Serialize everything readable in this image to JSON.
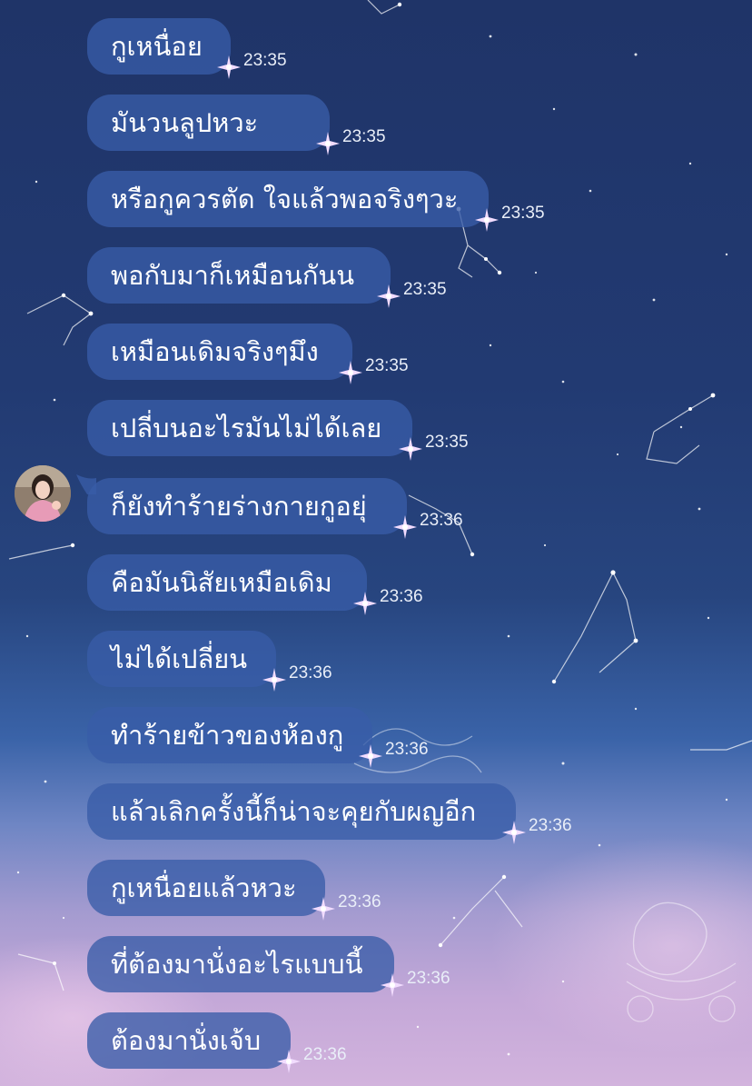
{
  "colors": {
    "bubble": "#385ca8",
    "text": "#ffffff",
    "time": "#e9eef8",
    "sparkle": "#f2dcff"
  },
  "chat": {
    "messages": [
      {
        "text": "กูเหนื่อย",
        "time": "23:35"
      },
      {
        "text": "มันวนลูปหวะ",
        "time": "23:35"
      },
      {
        "text": "หรือกูควรตัด ใจแล้วพอจริงๆวะ",
        "time": "23:35"
      },
      {
        "text": "พอกับมาก็เหมือนกันน",
        "time": "23:35"
      },
      {
        "text": "เหมือนเดิมจริงๆมึง",
        "time": "23:35"
      },
      {
        "text": "เปลี่บนอะไรมันไม่ได้เลย",
        "time": "23:35"
      },
      {
        "text": "ก็ยังทำร้ายร่างกายกูอยุ่",
        "time": "23:36"
      },
      {
        "text": "คือมันนิสัยเหมือเดิม",
        "time": "23:36"
      },
      {
        "text": "ไม่ได้เปลี่ยน",
        "time": "23:36"
      },
      {
        "text": "ทำร้ายข้าวของห้องกู",
        "time": "23:36"
      },
      {
        "text": "แล้วเลิกครั้งนี้ก็น่าจะคุยกับผญอีก",
        "time": "23:36"
      },
      {
        "text": "กูเหนื่อยแล้วหวะ",
        "time": "23:36"
      },
      {
        "text": "ที่ต้องมานั่งอะไรแบบนี้",
        "time": "23:36"
      },
      {
        "text": "ต้องมานั่งเจ้บ",
        "time": "23:36"
      }
    ]
  }
}
